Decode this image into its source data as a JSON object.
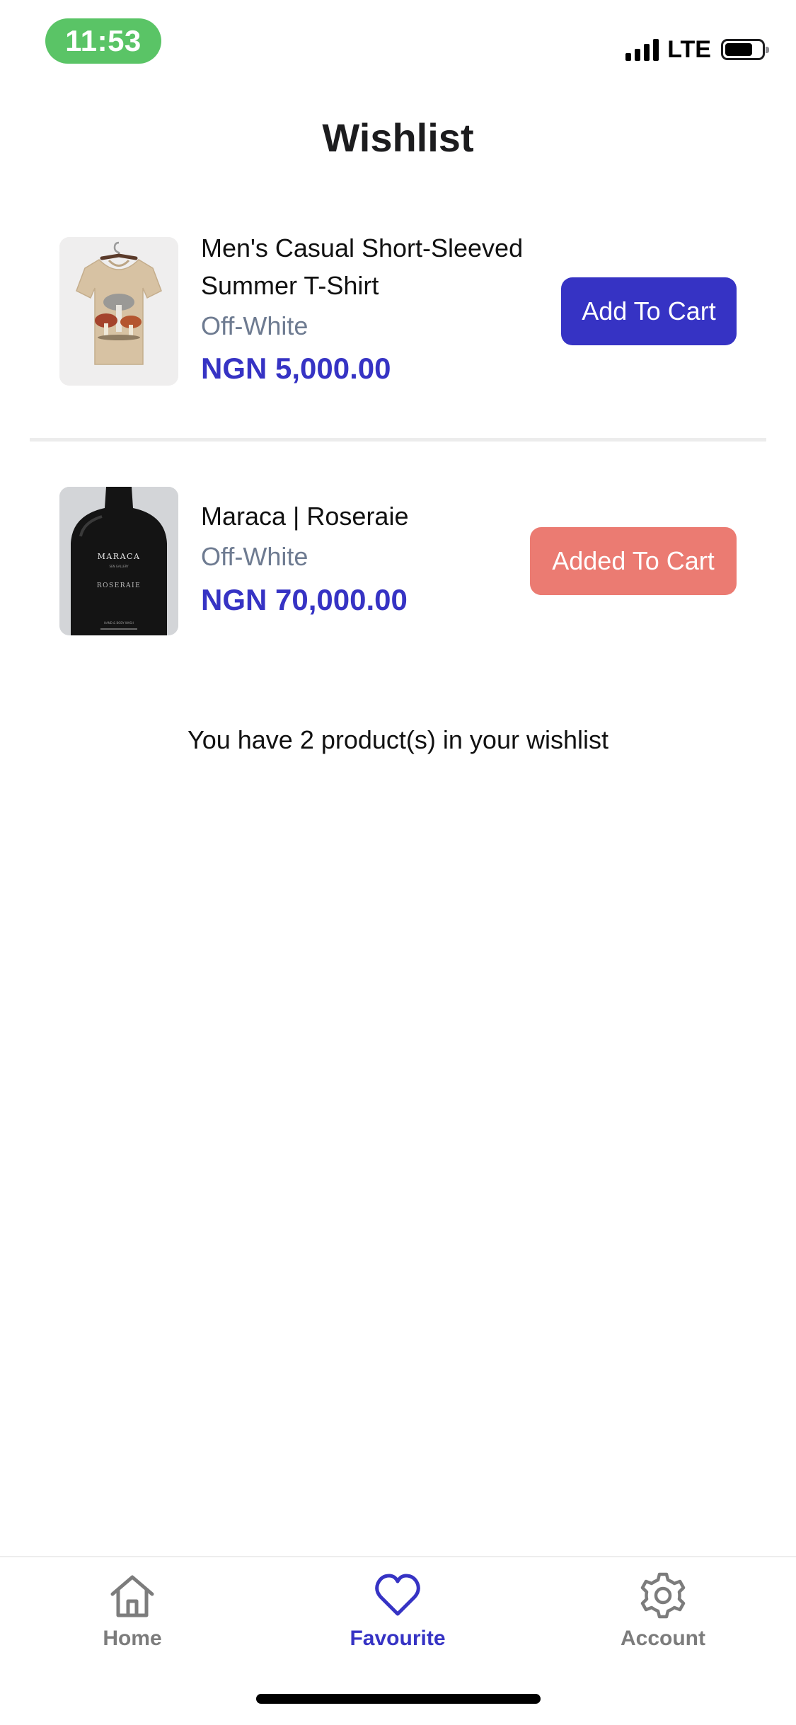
{
  "status_bar": {
    "time": "11:53",
    "network": "LTE",
    "battery_level": 0.75
  },
  "header": {
    "title": "Wishlist"
  },
  "wishlist": {
    "items": [
      {
        "name": "Men's Casual Short-Sleeved Summer T-Shirt",
        "variant": "Off-White",
        "price": "NGN 5,000.00",
        "button_label": "Add To Cart",
        "button_state": "add",
        "button_color": "#3633c4"
      },
      {
        "name": "Maraca | Roseraie",
        "variant": "Off-White",
        "price": "NGN 70,000.00",
        "button_label": "Added To Cart",
        "button_state": "added",
        "button_color": "#eb7b72",
        "product_label": {
          "brand": "MARACA",
          "sub": "SEN GALLERY",
          "line": "ROSERAIE",
          "small": "HAND & BODY WASH"
        }
      }
    ],
    "summary": "You have 2 product(s) in your wishlist"
  },
  "tabbar": {
    "tabs": [
      {
        "label": "Home",
        "icon": "home-icon",
        "active": false
      },
      {
        "label": "Favourite",
        "icon": "heart-icon",
        "active": true
      },
      {
        "label": "Account",
        "icon": "gear-icon",
        "active": false
      }
    ],
    "active_color": "#3633c4",
    "inactive_color": "#7c7c7c"
  },
  "colors": {
    "accent": "#3633c4",
    "added": "#eb7b72",
    "muted_text": "#6e7b91",
    "status_pill": "#5ac466"
  }
}
